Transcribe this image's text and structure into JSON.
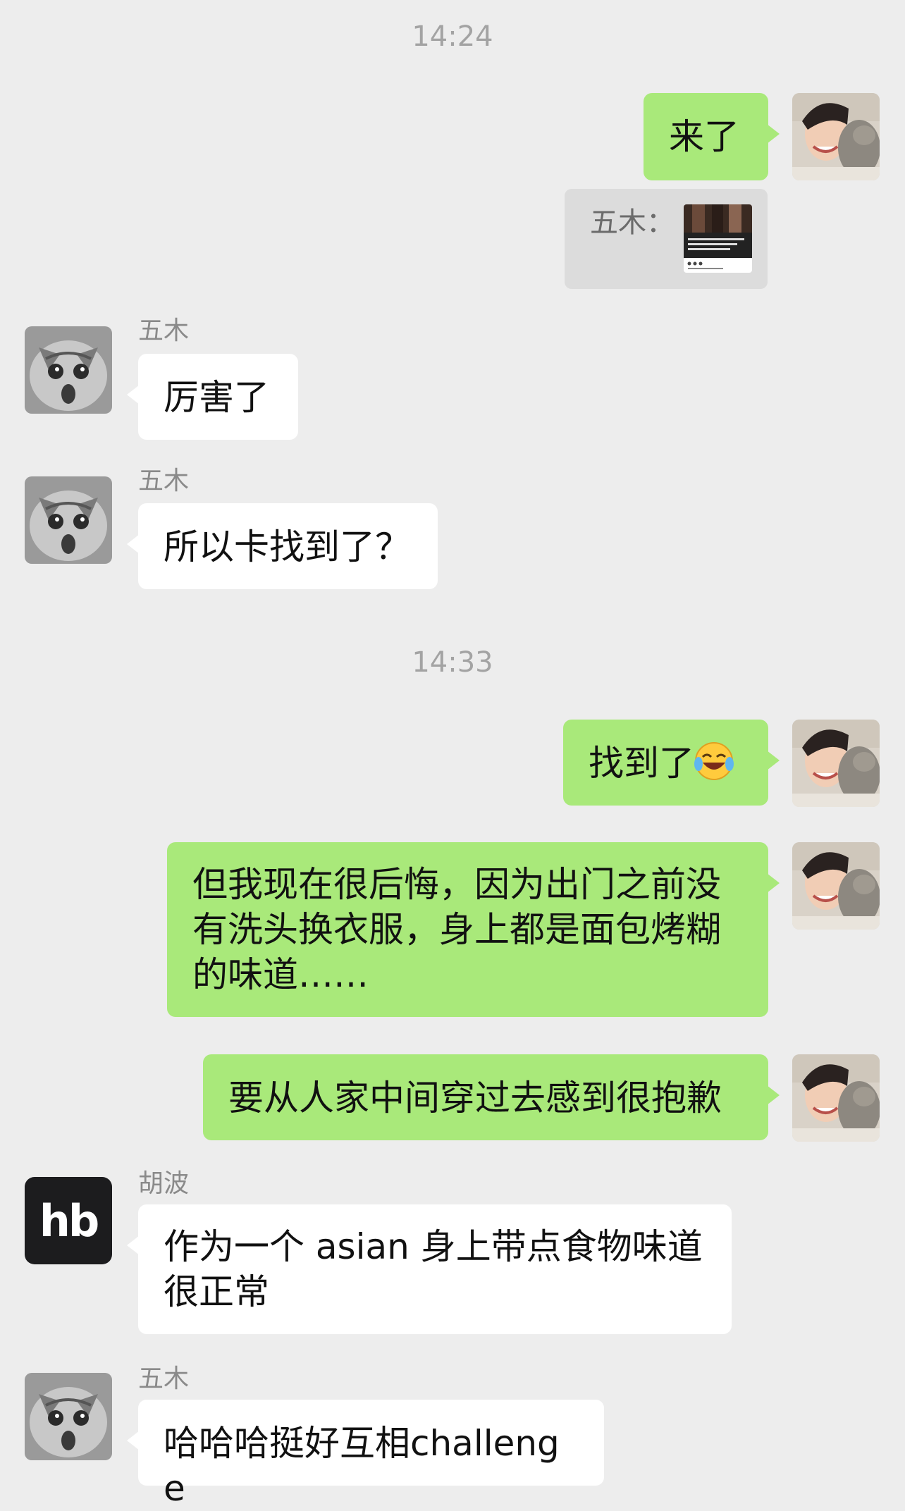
{
  "timestamps": [
    "14:24",
    "14:33"
  ],
  "quote": {
    "label": "五木：",
    "thumb_caption": "Visitors must squeeze between nude models to enter this art exhibition"
  },
  "messages": [
    {
      "text": "来了"
    },
    {
      "sender": "五木",
      "text": "厉害了"
    },
    {
      "sender": "五木",
      "text": "所以卡找到了？"
    },
    {
      "text": "找到了"
    },
    {
      "text": "但我现在很后悔，因为出门之前没有洗头换衣服，身上都是面包烤糊的味道……"
    },
    {
      "text": "要从人家中间穿过去感到很抱歉"
    },
    {
      "sender": "胡波",
      "text": "作为一个 asian 身上带点食物味道很正常"
    },
    {
      "sender": "五木",
      "text": "哈哈哈挺好互相challenge"
    }
  ],
  "avatars": {
    "hb_logo": "hb"
  },
  "colors": {
    "background": "#ededed",
    "mine_bubble": "#a9e97a",
    "theirs_bubble": "#ffffff"
  }
}
